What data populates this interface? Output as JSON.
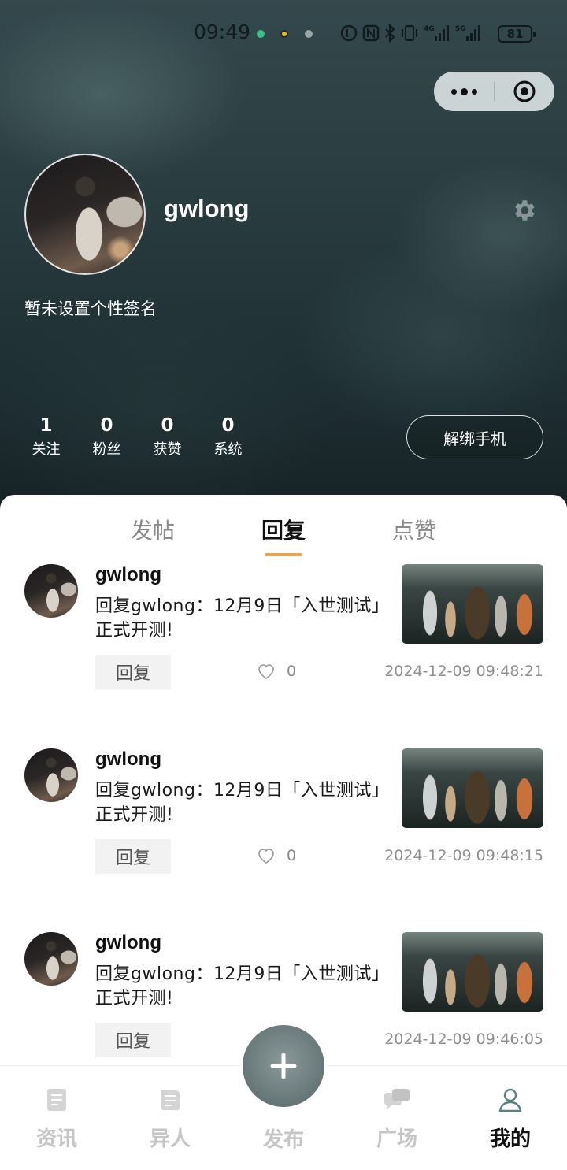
{
  "status_bar": {
    "time": "09:49",
    "battery": "81"
  },
  "profile": {
    "username": "gwlong",
    "signature": "暂未设置个性签名",
    "stats": [
      {
        "value": "1",
        "label": "关注"
      },
      {
        "value": "0",
        "label": "粉丝"
      },
      {
        "value": "0",
        "label": "获赞"
      },
      {
        "value": "0",
        "label": "系统"
      }
    ],
    "unbind_button": "解绑手机"
  },
  "tabs": [
    {
      "label": "发帖",
      "active": false
    },
    {
      "label": "回复",
      "active": true
    },
    {
      "label": "点赞",
      "active": false
    }
  ],
  "replies": [
    {
      "username": "gwlong",
      "text": "回复gwlong：12月9日「入世测试」正式开测!",
      "reply_label": "回复",
      "likes": "0",
      "time": "2024-12-09 09:48:21"
    },
    {
      "username": "gwlong",
      "text": "回复gwlong：12月9日「入世测试」正式开测!",
      "reply_label": "回复",
      "likes": "0",
      "time": "2024-12-09 09:48:15"
    },
    {
      "username": "gwlong",
      "text": "回复gwlong：12月9日「入世测试」正式开测!",
      "reply_label": "回复",
      "likes": "0",
      "time": "2024-12-09 09:46:05"
    }
  ],
  "bottom_nav": {
    "items": [
      {
        "label": "资讯",
        "icon": "news-icon"
      },
      {
        "label": "异人",
        "icon": "scroll-icon"
      },
      {
        "label": "发布",
        "icon": "plus-icon"
      },
      {
        "label": "广场",
        "icon": "chat-bubbles-icon"
      },
      {
        "label": "我的",
        "icon": "person-icon",
        "active": true
      }
    ]
  },
  "colors": {
    "accent": "#e8a34c",
    "header_dark": "#1f3034",
    "fab": "#6e7e7e"
  }
}
